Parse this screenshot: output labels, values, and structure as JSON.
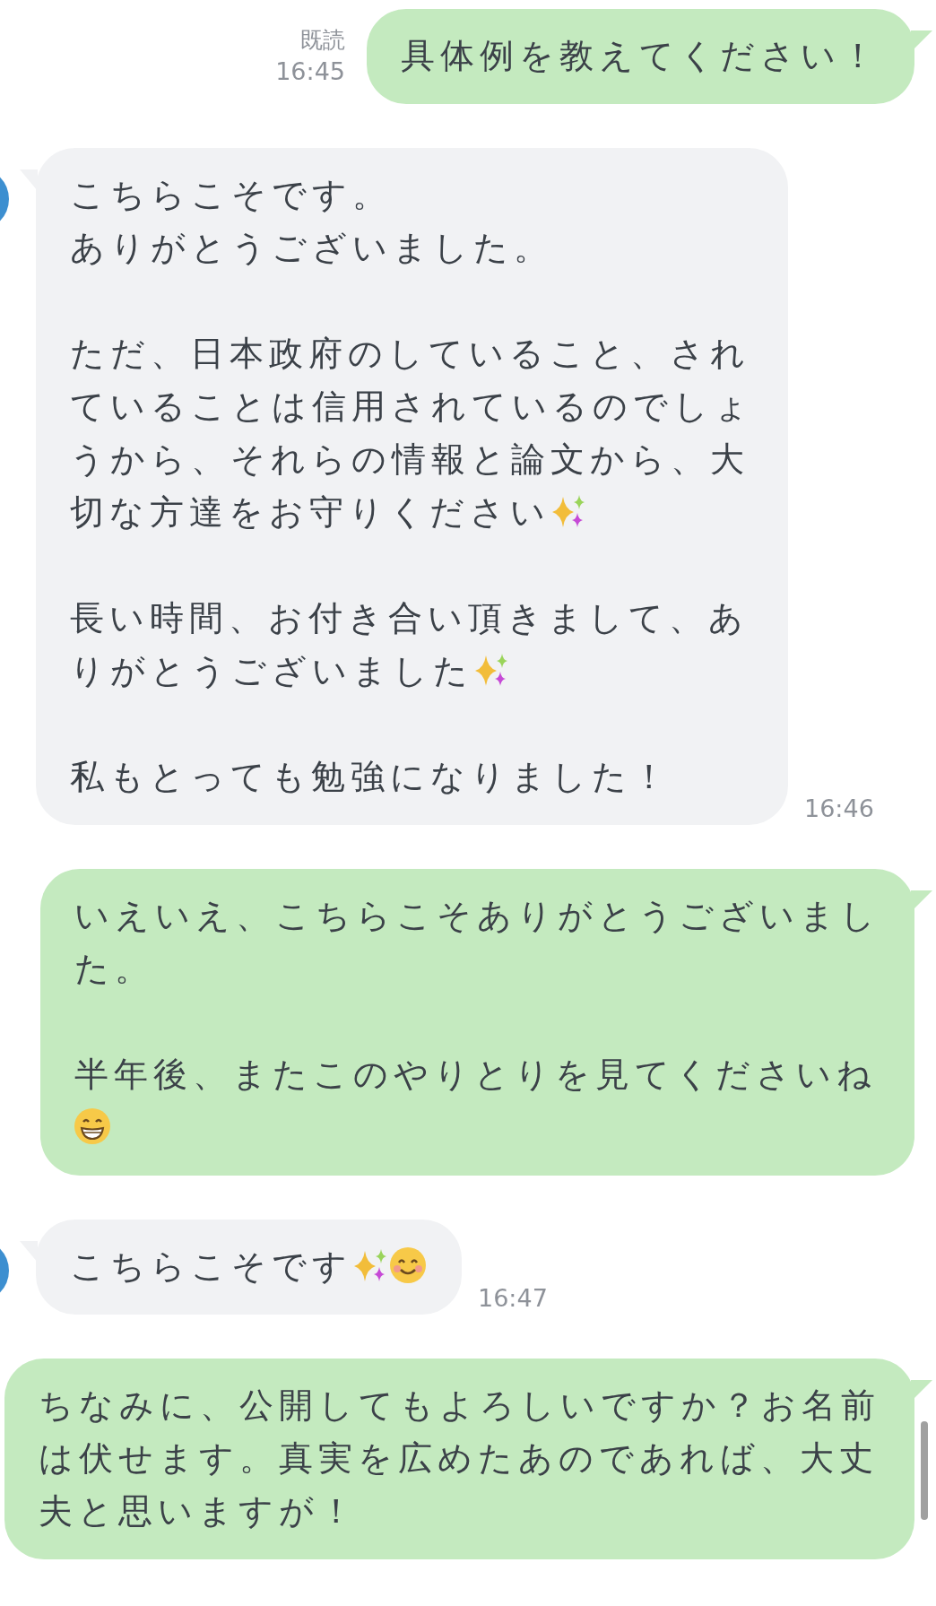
{
  "messages": [
    {
      "kind": "sent",
      "read_label": "既読",
      "time": "16:45",
      "paragraphs": [
        {
          "lines": [
            "具体例を教えてください！"
          ]
        }
      ]
    },
    {
      "kind": "received",
      "time": "16:46",
      "paragraphs": [
        {
          "lines": [
            "こちらこそです。",
            "ありがとうございました。"
          ]
        },
        {
          "lines": [
            "ただ、日本政府のしていること、され",
            "ていることは信用されているのでしょ",
            "うから、それらの情報と論文から、大",
            "切な方達をお守りください"
          ],
          "emoji": [
            {
              "kind": "sparkles"
            }
          ]
        },
        {
          "lines": [
            "長い時間、お付き合い頂きまして、あ",
            "りがとうございました"
          ],
          "emoji": [
            {
              "kind": "sparkles"
            }
          ]
        },
        {
          "lines": [
            "私もとっても勉強になりました！"
          ]
        }
      ]
    },
    {
      "kind": "sent",
      "paragraphs": [
        {
          "lines": [
            "いえいえ、こちらこそありがとうございまし",
            "た。"
          ]
        },
        {
          "lines": [
            "半年後、またこのやりとりを見てくださいね"
          ],
          "emoji_line": [
            {
              "kind": "grinning"
            }
          ]
        }
      ]
    },
    {
      "kind": "received",
      "time": "16:47",
      "paragraphs": [
        {
          "lines": [
            "こちらこそです"
          ],
          "emoji": [
            {
              "kind": "sparkles"
            },
            {
              "kind": "smiling"
            }
          ]
        }
      ]
    },
    {
      "kind": "sent",
      "paragraphs": [
        {
          "lines": [
            "ちなみに、公開してもよろしいですか？お名前",
            "は伏せます。真実を広めたあのであれば、大丈",
            "夫と思いますが！"
          ]
        }
      ]
    }
  ]
}
